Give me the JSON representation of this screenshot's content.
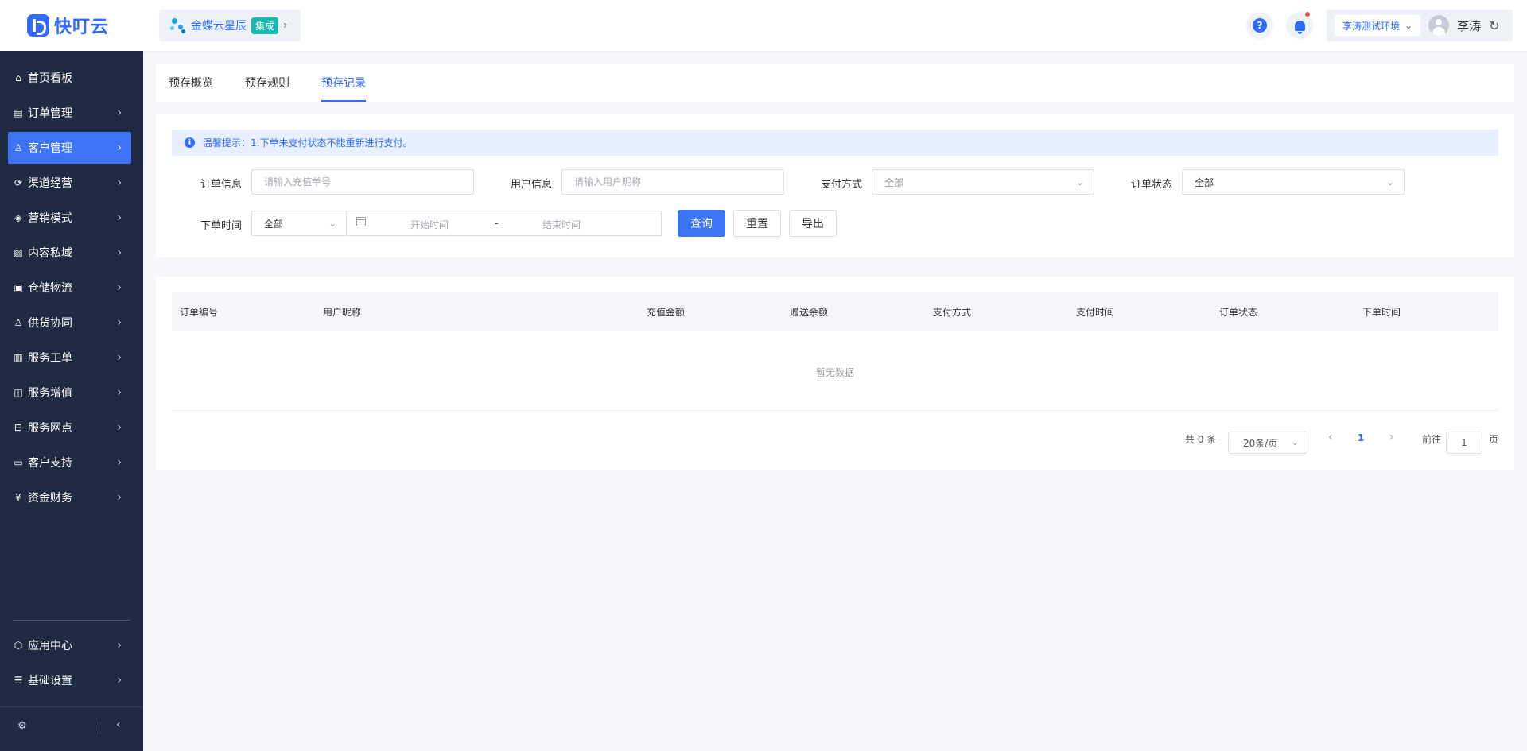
{
  "header": {
    "logo_text": "快叮云",
    "integration": {
      "label": "金蝶云星辰",
      "badge": "集成"
    },
    "env_label": "李涛测试环境",
    "user_name": "李涛"
  },
  "sidebar": {
    "items": [
      {
        "label": "首页看板",
        "icon": "home-icon",
        "arrow": false
      },
      {
        "label": "订单管理",
        "icon": "order-icon",
        "arrow": true
      },
      {
        "label": "客户管理",
        "icon": "user-icon",
        "arrow": true,
        "active": true
      },
      {
        "label": "渠道经营",
        "icon": "channel-icon",
        "arrow": true
      },
      {
        "label": "营销模式",
        "icon": "tag-icon",
        "arrow": true
      },
      {
        "label": "内容私域",
        "icon": "image-icon",
        "arrow": true
      },
      {
        "label": "仓储物流",
        "icon": "warehouse-icon",
        "arrow": true
      },
      {
        "label": "供货协同",
        "icon": "supply-icon",
        "arrow": true
      },
      {
        "label": "服务工单",
        "icon": "ticket-icon",
        "arrow": true
      },
      {
        "label": "服务增值",
        "icon": "bag-icon",
        "arrow": true
      },
      {
        "label": "服务网点",
        "icon": "store-icon",
        "arrow": true
      },
      {
        "label": "客户支持",
        "icon": "support-icon",
        "arrow": true
      },
      {
        "label": "资金财务",
        "icon": "yuan-icon",
        "arrow": true
      }
    ],
    "bottom_items": [
      {
        "label": "应用中心",
        "icon": "cube-icon"
      },
      {
        "label": "基础设置",
        "icon": "sliders-icon"
      }
    ]
  },
  "tabs": [
    {
      "label": "预存概览"
    },
    {
      "label": "预存规则"
    },
    {
      "label": "预存记录",
      "active": true
    }
  ],
  "tip": "温馨提示：1.下单未支付状态不能重新进行支付。",
  "filters": {
    "order_info": {
      "label": "订单信息",
      "placeholder": "请输入充值单号"
    },
    "user_info": {
      "label": "用户信息",
      "placeholder": "请输入用户昵称"
    },
    "pay_method": {
      "label": "支付方式",
      "value": "全部"
    },
    "order_status": {
      "label": "订单状态",
      "value": "全部"
    },
    "order_time": {
      "label": "下单时间",
      "value": "全部",
      "start_placeholder": "开始时间",
      "separator": "-",
      "end_placeholder": "结束时间"
    }
  },
  "buttons": {
    "query": "查询",
    "reset": "重置",
    "export": "导出"
  },
  "table": {
    "columns": [
      "订单编号",
      "用户昵称",
      "充值金额",
      "赠送余额",
      "支付方式",
      "支付时间",
      "订单状态",
      "下单时间"
    ],
    "empty_text": "暂无数据"
  },
  "pagination": {
    "total_text": "共 0 条",
    "page_size": "20条/页",
    "current_page": "1",
    "goto_label": "前往",
    "goto_value": "1",
    "page_suffix": "页"
  }
}
